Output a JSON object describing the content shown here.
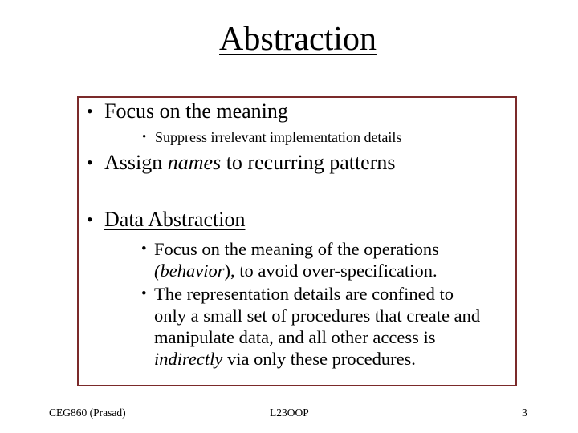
{
  "slide": {
    "title": "Abstraction",
    "frame_color": "#7b2a2a",
    "bullets": [
      {
        "text": "Focus on the meaning",
        "sub": [
          {
            "text": "Suppress irrelevant implementation details"
          }
        ]
      },
      {
        "pre": "Assign ",
        "em": "names",
        "post": " to recurring patterns"
      },
      {
        "text": "Data Abstraction",
        "underline": true,
        "sub": [
          {
            "lines": [
              {
                "text": "Focus on the meaning of the operations"
              },
              {
                "em": "(behavior",
                "post": "),  to avoid over-specification."
              }
            ]
          },
          {
            "lines": [
              {
                "text": "The representation details are confined to"
              },
              {
                "text": "only a small set of procedures that create and"
              },
              {
                "text": "manipulate data, and all other access is"
              },
              {
                "em": "indirectly",
                "post": " via only these procedures."
              }
            ]
          }
        ]
      }
    ]
  },
  "footer": {
    "course": "CEG860  (Prasad)",
    "lecture": "L23OOP",
    "page_number": "3"
  },
  "icons": {
    "bullet": "•"
  }
}
